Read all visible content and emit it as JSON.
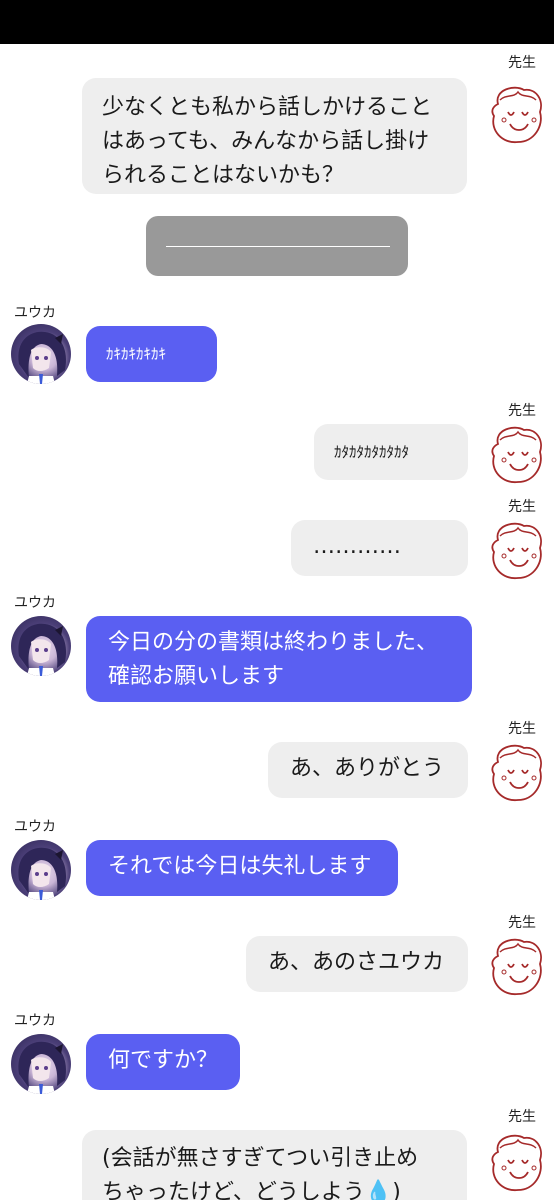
{
  "names": {
    "teacher": "先生",
    "yuuka": "ユウカ"
  },
  "messages": [
    {
      "from": "teacher",
      "lines": [
        "少なくとも私から話しかけること",
        "はあっても、みんなから話し掛け",
        "られることはないかも？"
      ]
    },
    {
      "from": "choice",
      "text": "————————————"
    },
    {
      "from": "yuuka",
      "lines": [
        "ｶｷｶｷｶｷｶｷ"
      ]
    },
    {
      "from": "teacher",
      "lines": [
        "ｶﾀｶﾀｶﾀｶﾀｶﾀ"
      ]
    },
    {
      "from": "teacher",
      "lines": [
        "…………"
      ]
    },
    {
      "from": "yuuka",
      "lines": [
        "今日の分の書類は終わりました、",
        "確認お願いします"
      ]
    },
    {
      "from": "teacher",
      "lines": [
        "あ、ありがとう"
      ]
    },
    {
      "from": "yuuka",
      "lines": [
        "それでは今日は失礼します"
      ]
    },
    {
      "from": "teacher",
      "lines": [
        "あ、あのさユウカ"
      ]
    },
    {
      "from": "yuuka",
      "lines": [
        "何ですか？"
      ]
    },
    {
      "from": "teacher",
      "lines": [
        "(会話が無さすぎてつい引き止め",
        "ちゃったけど、どうしよう💧)"
      ]
    }
  ],
  "icons": {
    "teacher_avatar": "smiley-doodle-icon",
    "yuuka_avatar": "yuuka-portrait-icon"
  }
}
